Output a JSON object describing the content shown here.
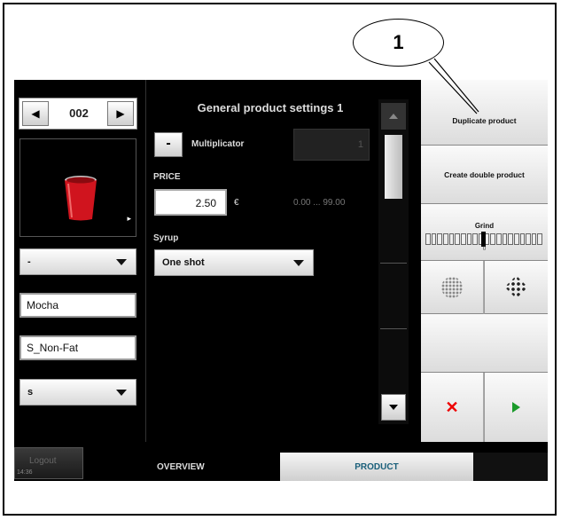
{
  "callout": {
    "number": "1"
  },
  "left": {
    "nav": {
      "prev_icon": "◀",
      "number": "002",
      "next_icon": "▶"
    },
    "image": {
      "icon": "red-cup",
      "arrow": "▸"
    },
    "dropdown1": {
      "value": "-"
    },
    "field1": {
      "value": "Mocha"
    },
    "field2": {
      "value": "S_Non-Fat"
    },
    "dropdown2": {
      "value": "s"
    }
  },
  "middle": {
    "title": "General product settings 1",
    "minus_label": "-",
    "multiplicator_label": "Multiplicator",
    "multiplicator_value": "1",
    "price_label": "PRICE",
    "price_value": "2.50",
    "currency": "€",
    "price_range": "0.00 ... 99.00",
    "syrup_label": "Syrup",
    "syrup_value": "One shot"
  },
  "right": {
    "duplicate_label": "Duplicate product",
    "create_double_label": "Create double product",
    "grind_label": "Grind",
    "grind_zero": "0",
    "coarse_icon": "coarse-grind-icon",
    "fine_icon": "fine-grind-icon",
    "cancel_icon": "✕",
    "confirm_icon": "play"
  },
  "bottom": {
    "logout_label": "Logout",
    "clock": "14:36",
    "tab_overview": "OVERVIEW",
    "tab_product": "PRODUCT"
  },
  "colors": {
    "accent_red": "#e00000",
    "accent_green": "#1a9a2a",
    "tab_text": "#1a5f7a"
  }
}
